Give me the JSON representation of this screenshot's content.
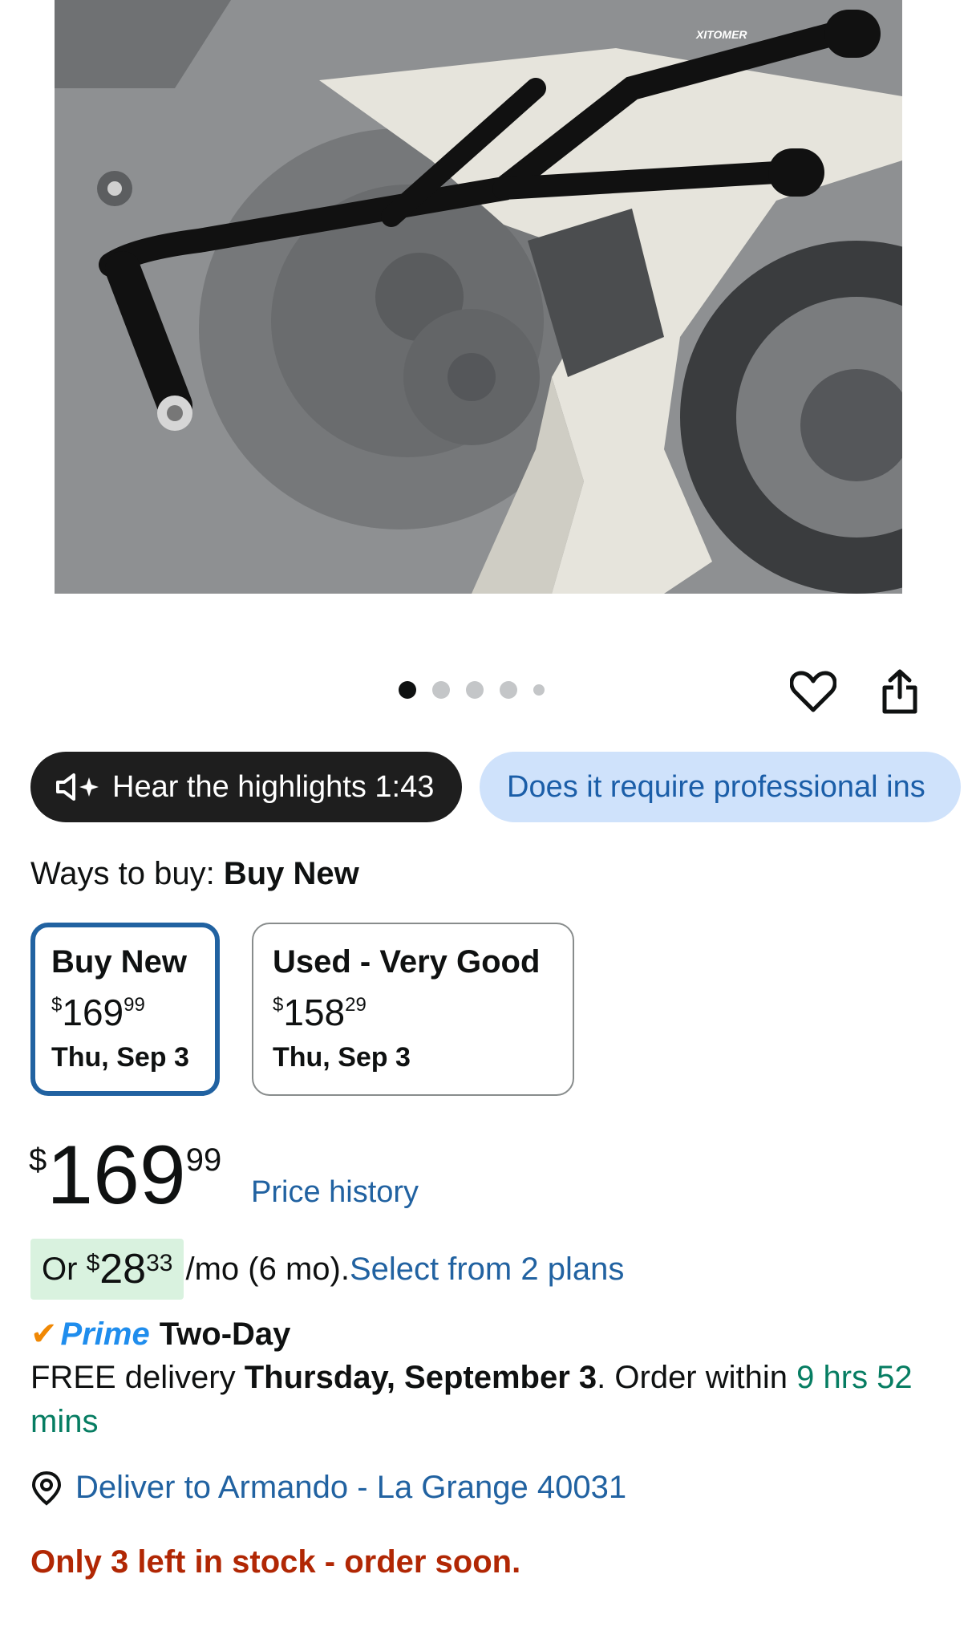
{
  "product_image": {
    "alt_brand_mark": "XITOMER"
  },
  "carousel": {
    "total": 5,
    "active_index": 0
  },
  "actions": {
    "heart_icon": "heart-icon",
    "share_icon": "share-icon"
  },
  "pills": {
    "highlights": "Hear the highlights 1:43",
    "question": "Does it require professional ins"
  },
  "ways_to_buy": {
    "label": "Ways to buy:",
    "value": "Buy New"
  },
  "buy_options": [
    {
      "title": "Buy New",
      "currency": "$",
      "whole": "169",
      "fraction": "99",
      "date": "Thu, Sep 3",
      "selected": true
    },
    {
      "title": "Used - Very Good",
      "currency": "$",
      "whole": "158",
      "fraction": "29",
      "date": "Thu, Sep 3",
      "selected": false
    }
  ],
  "price": {
    "currency": "$",
    "whole": "169",
    "fraction": "99",
    "history_link": "Price history"
  },
  "installment": {
    "prefix": "Or",
    "currency": "$",
    "whole": "28",
    "fraction": "33",
    "suffix": "/mo (6 mo).",
    "link": "Select from 2 plans"
  },
  "prime": {
    "check": "✔",
    "label": "Prime",
    "speed": "Two-Day"
  },
  "delivery": {
    "prefix": "FREE delivery",
    "date": "Thursday, September 3",
    "middle": ". Order within",
    "timer": "9 hrs 52 mins"
  },
  "deliver_to": {
    "text": "Deliver to Armando - La Grange 40031"
  },
  "stock": {
    "text": "Only 3 left in stock - order soon."
  },
  "colors": {
    "link": "#2162a1",
    "selected_border": "#2162a1",
    "stock_red": "#b12704",
    "timer_green": "#067d62",
    "prime_blue": "#1f8ded",
    "prime_check": "#f08804",
    "installment_bg": "#d9f2df",
    "question_pill_bg": "#cfe2fb"
  }
}
